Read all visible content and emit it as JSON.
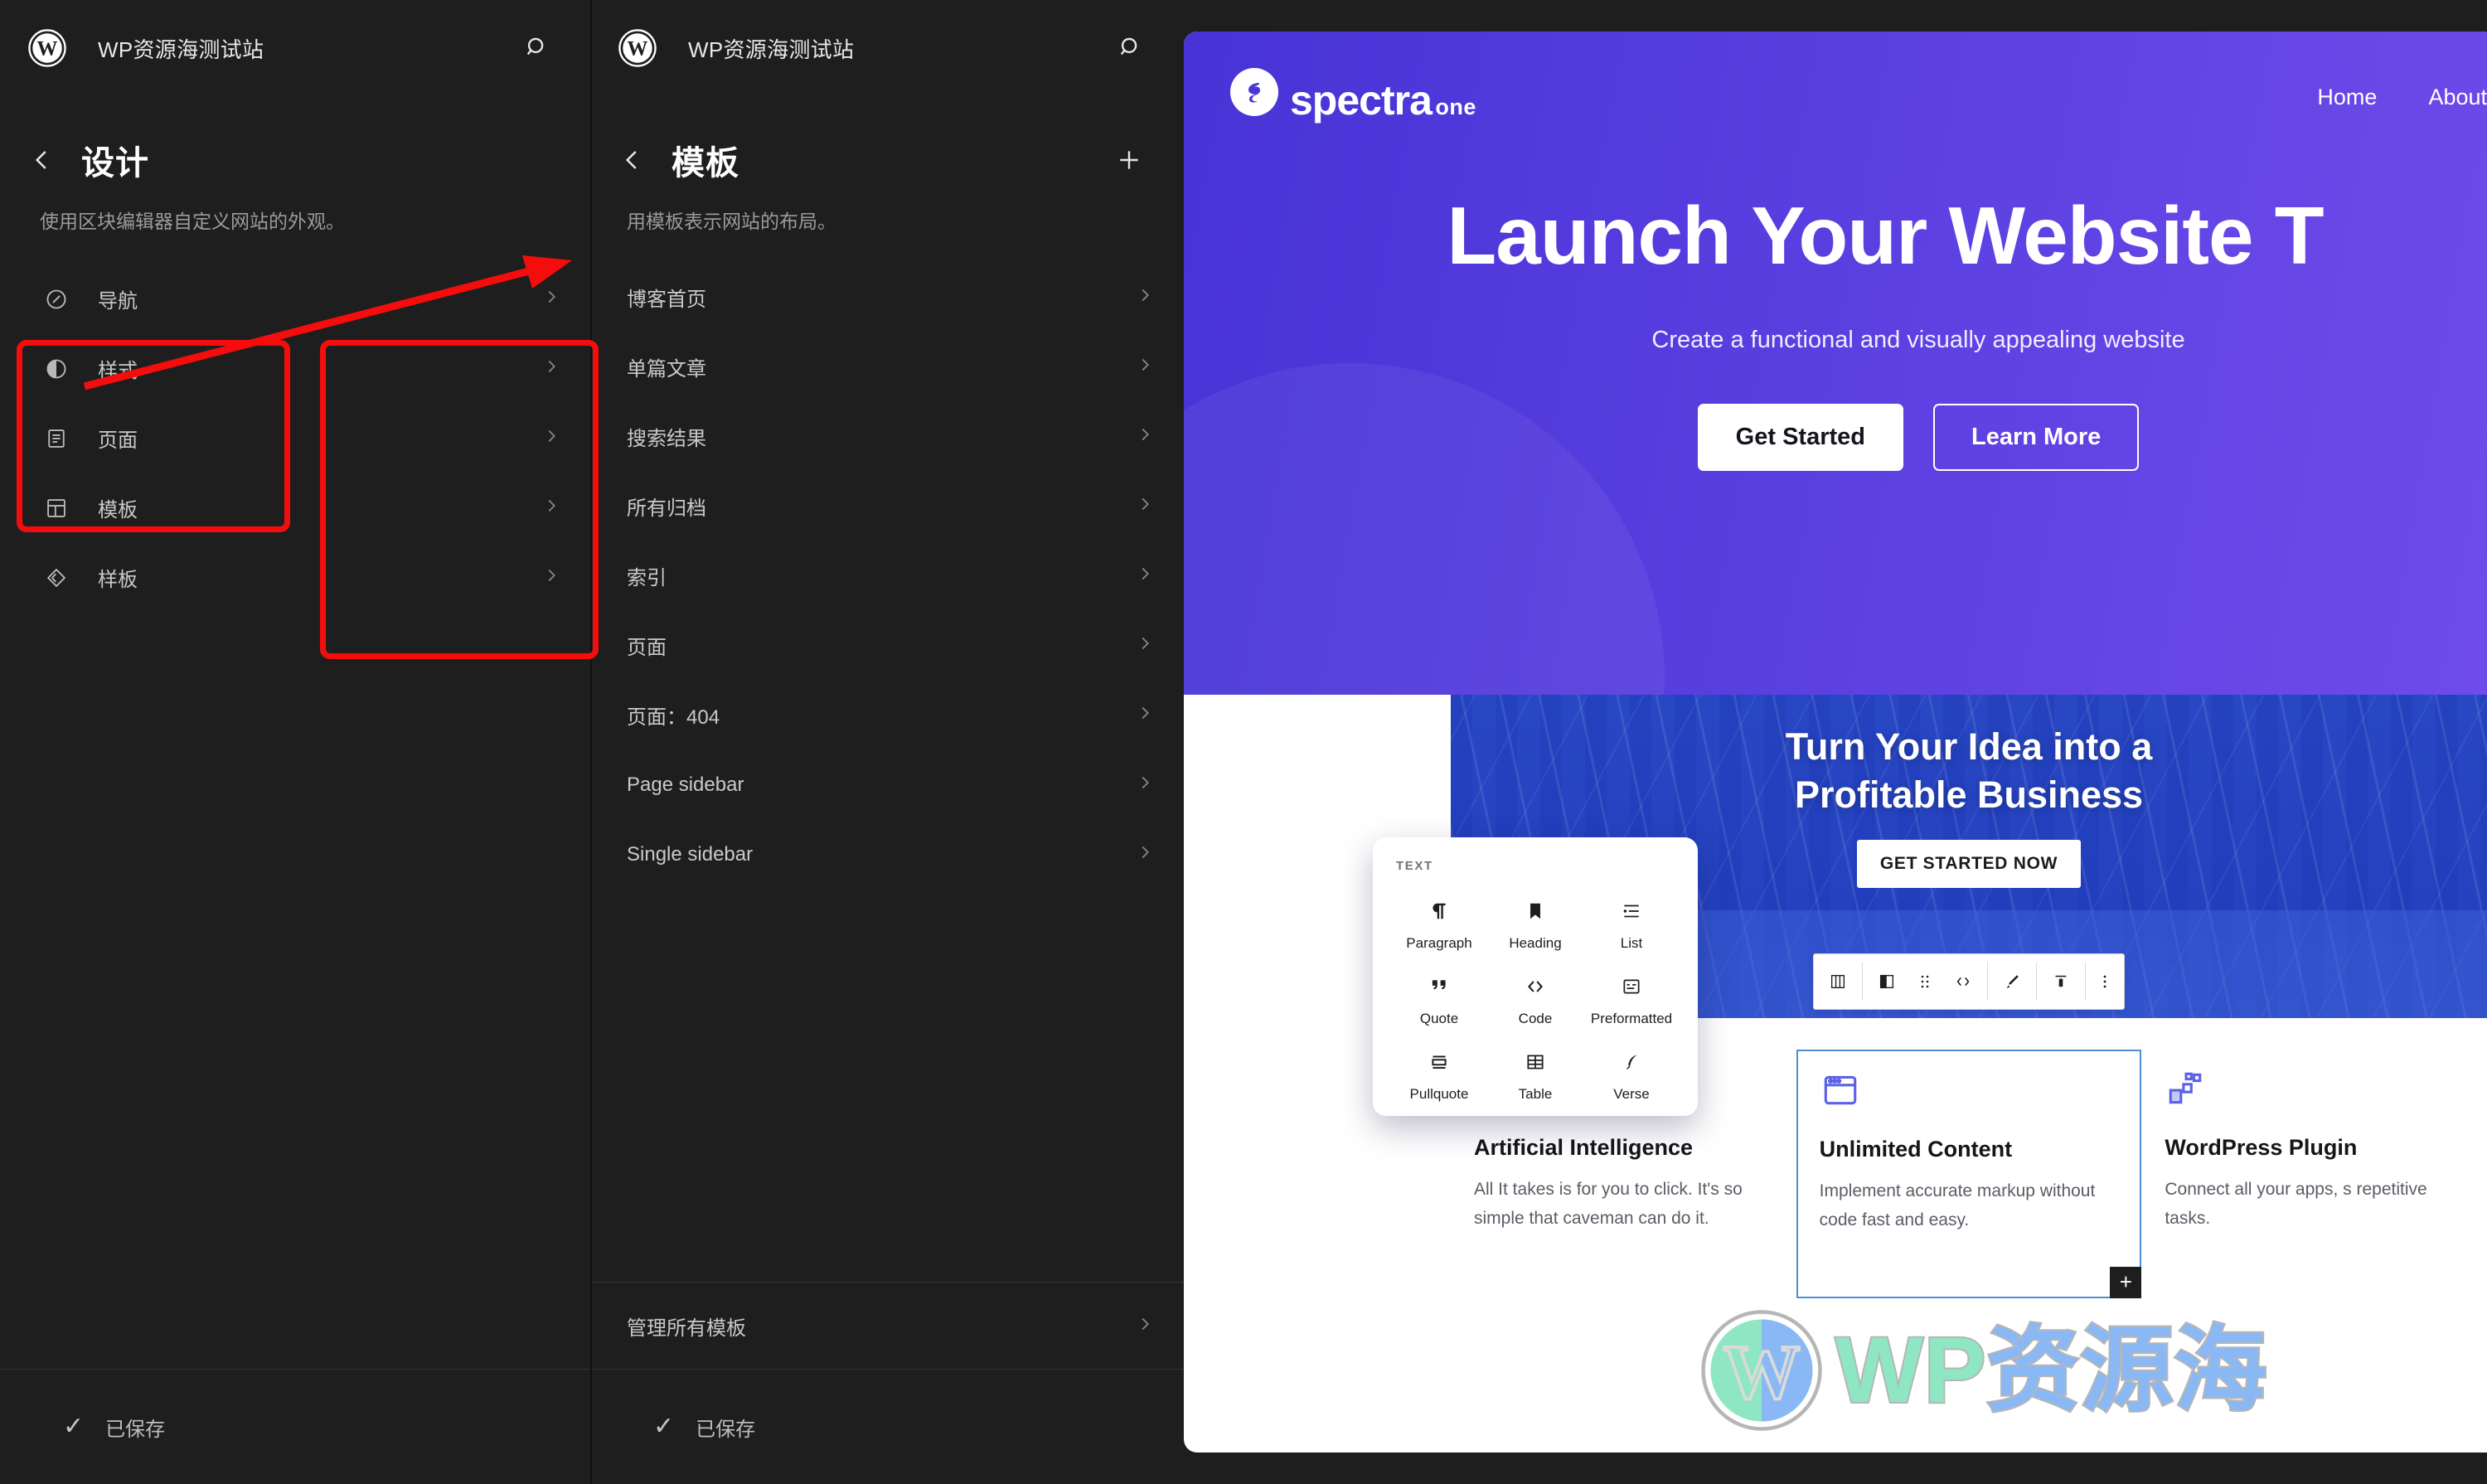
{
  "site": {
    "title": "WP资源海测试站",
    "logo_icon": "wordpress-logo-icon",
    "search_icon": "search-icon"
  },
  "design_panel": {
    "back_icon": "chevron-left-icon",
    "title": "设计",
    "description": "使用区块编辑器自定义网站的外观。",
    "items": [
      {
        "label": "导航",
        "icon": "compass-icon",
        "chevron": "chevron-right-icon"
      },
      {
        "label": "样式",
        "icon": "contrast-half-circle-icon",
        "chevron": "chevron-right-icon"
      },
      {
        "label": "页面",
        "icon": "page-document-icon",
        "chevron": "chevron-right-icon"
      },
      {
        "label": "模板",
        "icon": "template-layout-icon",
        "chevron": "chevron-right-icon"
      },
      {
        "label": "样板",
        "icon": "pattern-diamond-icon",
        "chevron": "chevron-right-icon"
      }
    ],
    "saved_label": "已保存",
    "saved_icon": "checkmark-icon"
  },
  "templates_panel": {
    "back_icon": "chevron-left-icon",
    "title": "模板",
    "add_icon": "plus-icon",
    "description": "用模板表示网站的布局。",
    "items": [
      {
        "label": "博客首页",
        "chevron": "chevron-right-icon"
      },
      {
        "label": "单篇文章",
        "chevron": "chevron-right-icon"
      },
      {
        "label": "搜索结果",
        "chevron": "chevron-right-icon"
      },
      {
        "label": "所有归档",
        "chevron": "chevron-right-icon"
      },
      {
        "label": "索引",
        "chevron": "chevron-right-icon"
      },
      {
        "label": "页面",
        "chevron": "chevron-right-icon"
      },
      {
        "label": "页面：404",
        "chevron": "chevron-right-icon"
      },
      {
        "label": "Page sidebar",
        "chevron": "chevron-right-icon"
      },
      {
        "label": "Single sidebar",
        "chevron": "chevron-right-icon"
      }
    ],
    "manage_label": "管理所有模板",
    "manage_chevron": "chevron-right-icon",
    "saved_label": "已保存",
    "saved_icon": "checkmark-icon"
  },
  "preview": {
    "brand": {
      "main": "spectra",
      "sub": "one",
      "mark_icon": "spectra-s-icon"
    },
    "nav": [
      {
        "label": "Home"
      },
      {
        "label": "About"
      }
    ],
    "hero": {
      "heading": "Launch Your Website T",
      "subheading": "Create a functional and visually appealing website",
      "primary_button": "Get Started",
      "secondary_button": "Learn More"
    },
    "midband": {
      "heading_line1": "Turn Your Idea into a",
      "heading_line2": "Profitable Business",
      "button": "GET STARTED NOW"
    },
    "features": [
      {
        "icon": "gear-icon",
        "title": "Artificial Intelligence",
        "description": "All It takes is for you to click. It's so simple that caveman can do it."
      },
      {
        "icon": "browser-window-icon",
        "title": "Unlimited Content",
        "description": "Implement accurate markup without code fast and easy.",
        "selected": true,
        "add_block_icon": "plus-icon"
      },
      {
        "icon": "blocks-scatter-icon",
        "title": "WordPress Plugin",
        "description": "Connect all your apps, s repetitive tasks."
      }
    ],
    "block_toolbar": [
      {
        "icon": "columns-block-icon"
      },
      {
        "icon": "column-block-icon"
      },
      {
        "icon": "drag-handle-icon"
      },
      {
        "icon": "move-arrows-icon"
      },
      {
        "icon": "paintbrush-icon"
      },
      {
        "icon": "align-top-icon"
      },
      {
        "icon": "more-options-icon"
      }
    ],
    "inserter": {
      "category": "TEXT",
      "blocks": [
        {
          "name": "Paragraph",
          "icon": "pilcrow-icon"
        },
        {
          "name": "Heading",
          "icon": "heading-bookmark-icon"
        },
        {
          "name": "List",
          "icon": "list-icon"
        },
        {
          "name": "Quote",
          "icon": "quote-marks-icon"
        },
        {
          "name": "Code",
          "icon": "code-brackets-icon"
        },
        {
          "name": "Preformatted",
          "icon": "preformatted-icon"
        },
        {
          "name": "Pullquote",
          "icon": "pullquote-icon"
        },
        {
          "name": "Table",
          "icon": "table-icon"
        },
        {
          "name": "Verse",
          "icon": "verse-feather-icon"
        }
      ]
    }
  },
  "watermark": {
    "wp_text": "WP",
    "cn_text": "资源海",
    "logo_icon": "wordpress-logo-icon"
  },
  "colors": {
    "panel_bg": "#1e1e1e",
    "hero_purple_start": "#4733d6",
    "hero_purple_end": "#6e4bea",
    "annotation_red": "#f50d0d",
    "selected_block_blue": "#4b8fd6"
  }
}
